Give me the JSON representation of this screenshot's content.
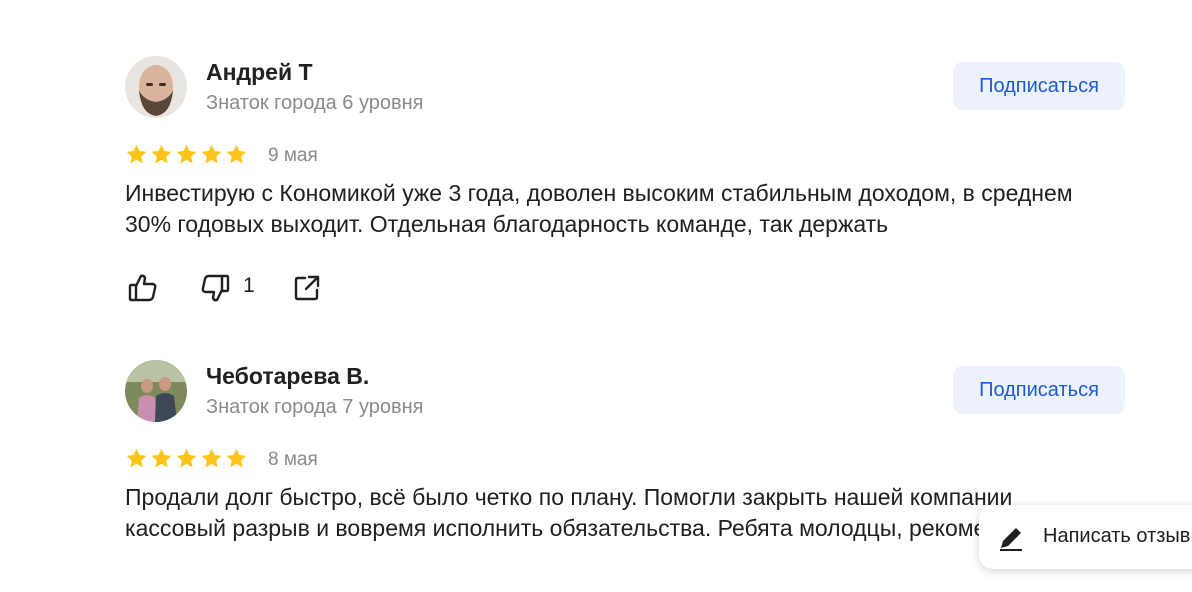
{
  "reviews": [
    {
      "author": "Андрей Т",
      "level": "Знаток города 6 уровня",
      "subscribe_label": "Подписаться",
      "rating": 5,
      "date": "9 мая",
      "text": "Инвестирую с Кономикой уже 3 года, доволен высоким стабильным доходом, в среднем 30% годовых выходит. Отдельная благодарность команде, так держать",
      "dislikes": "1"
    },
    {
      "author": "Чеботарева В.",
      "level": "Знаток города 7 уровня",
      "subscribe_label": "Подписаться",
      "rating": 5,
      "date": "8 мая",
      "text": "Продали долг быстро, всё было четко по плану. Помогли закрыть нашей компании кассовый разрыв и вовремя исполнить обязательства. Ребята молодцы, рекомендую."
    }
  ],
  "write_review_label": "Написать отзыв",
  "icons": {
    "star": "star-icon",
    "like": "thumbs-up-icon",
    "dislike": "thumbs-down-icon",
    "share": "share-icon",
    "pen": "pen-icon"
  },
  "colors": {
    "star": "#fcc419",
    "accent": "#1a5bd6",
    "button_bg": "#ecf1fb",
    "muted": "#8a8a8a"
  }
}
